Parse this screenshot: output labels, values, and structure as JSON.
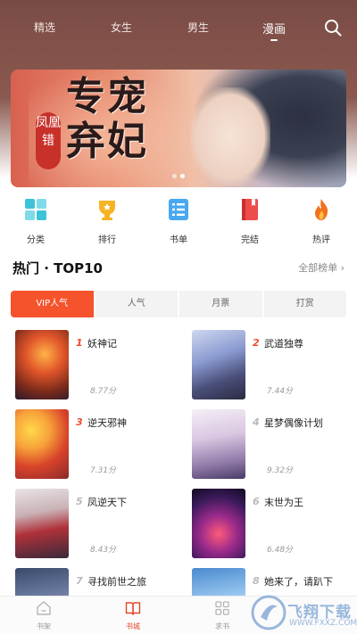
{
  "top_tabs": [
    {
      "label": "精选"
    },
    {
      "label": "女生"
    },
    {
      "label": "男生"
    },
    {
      "label": "漫画",
      "active": true
    }
  ],
  "banner": {
    "title": "专宠弃妃",
    "subtitle": "凤凰错"
  },
  "categories": [
    {
      "label": "分类",
      "icon": "grid-icon",
      "color": "#3cc3d8"
    },
    {
      "label": "排行",
      "icon": "trophy-icon",
      "color": "#f5b324"
    },
    {
      "label": "书单",
      "icon": "list-icon",
      "color": "#4aa8f0"
    },
    {
      "label": "完结",
      "icon": "book-icon",
      "color": "#ee4b4b"
    },
    {
      "label": "热评",
      "icon": "fire-icon",
      "color": "#f2711c"
    }
  ],
  "hot": {
    "title": "热门 · TOP10",
    "more": "全部榜单 ›"
  },
  "seg_tabs": [
    {
      "label": "VIP人气",
      "active": true
    },
    {
      "label": "人气"
    },
    {
      "label": "月票"
    },
    {
      "label": "打赏"
    }
  ],
  "rankings": [
    {
      "rank": "1",
      "name": "妖神记",
      "score": "8.77分"
    },
    {
      "rank": "2",
      "name": "武道独尊",
      "score": "7.44分"
    },
    {
      "rank": "3",
      "name": "逆天邪神",
      "score": "7.31分"
    },
    {
      "rank": "4",
      "name": "星梦偶像计划",
      "score": "9.32分"
    },
    {
      "rank": "5",
      "name": "凤逆天下",
      "score": "8.43分"
    },
    {
      "rank": "6",
      "name": "末世为王",
      "score": "6.48分"
    },
    {
      "rank": "7",
      "name": "寻找前世之旅",
      "score": ""
    },
    {
      "rank": "8",
      "name": "她来了，请趴下",
      "score": ""
    }
  ],
  "bottom_nav": [
    {
      "label": "书架",
      "icon": "home-icon"
    },
    {
      "label": "书城",
      "icon": "open-book-icon",
      "active": true
    },
    {
      "label": "求书",
      "icon": "apps-icon"
    }
  ],
  "watermark": {
    "text": "飞翔下载",
    "sub": "WWW.FXXZ.COM"
  },
  "colors": {
    "accent": "#f4532b",
    "rank_top": "#f04b2b",
    "rank_other": "#b9b9b9"
  }
}
